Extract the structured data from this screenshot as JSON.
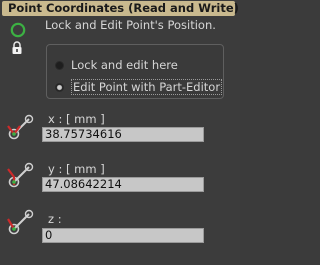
{
  "panel": {
    "title": "Point Coordinates (Read and Write)",
    "description": "Lock and Edit Point's Position.",
    "radio_options": [
      {
        "label": "Lock and edit here",
        "selected": false
      },
      {
        "label": "Edit Point with Part-Editor",
        "selected": true
      }
    ]
  },
  "coordinates": {
    "x": {
      "label": "x : [ mm ]",
      "value": "38.75734616"
    },
    "y": {
      "label": "y : [ mm ]",
      "value": "47.08642214"
    },
    "z": {
      "label": "z :",
      "value": "0"
    }
  },
  "colors": {
    "title_bar": "#c9b98e",
    "panel_bg": "#3c3c3c",
    "field_bg": "#c7c7c7",
    "lock_ring": "#3cb043",
    "axis_red": "#cc2a2a"
  },
  "icons": {
    "lock_ring": "green-ring-icon",
    "padlock": "padlock-icon",
    "coordinate": "point-on-axis-icon"
  }
}
